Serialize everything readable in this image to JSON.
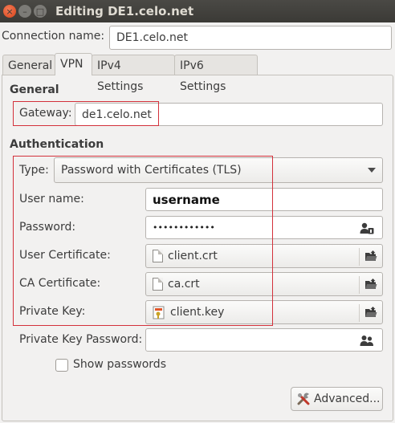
{
  "window": {
    "title": "Editing DE1.celo.net",
    "close_glyph": "×",
    "min_glyph": "–",
    "max_glyph": "□"
  },
  "connection_name": {
    "label": "Connection name:",
    "value": "DE1.celo.net"
  },
  "tabs": [
    {
      "label": "General"
    },
    {
      "label": "VPN"
    },
    {
      "label": "IPv4 Settings"
    },
    {
      "label": "IPv6 Settings"
    }
  ],
  "active_tab": "VPN",
  "general": {
    "heading": "General",
    "gateway_label": "Gateway:",
    "gateway_value": "de1.celo.net"
  },
  "authentication": {
    "heading": "Authentication",
    "type_label": "Type:",
    "type_value": "Password with Certificates (TLS)",
    "username_label": "User name:",
    "username_value": "username",
    "password_label": "Password:",
    "password_value": "••••••••••••",
    "user_cert_label": "User Certificate:",
    "user_cert_value": "client.crt",
    "ca_cert_label": "CA Certificate:",
    "ca_cert_value": "ca.crt",
    "private_key_label": "Private Key:",
    "private_key_value": "client.key",
    "private_key_password_label": "Private Key Password:",
    "private_key_password_value": "",
    "show_passwords_label": "Show passwords",
    "show_passwords_checked": false
  },
  "advanced_button_label": "Advanced...",
  "colors": {
    "highlight_box": "#d3313b",
    "titlebar": "#3b3a36",
    "close_button": "#e0562a"
  },
  "icons": [
    "close-icon",
    "minimize-icon",
    "maximize-icon",
    "dropdown-arrow-icon",
    "user-password-icon",
    "document-icon",
    "folder-open-icon",
    "certificate-key-icon",
    "tools-icon"
  ]
}
